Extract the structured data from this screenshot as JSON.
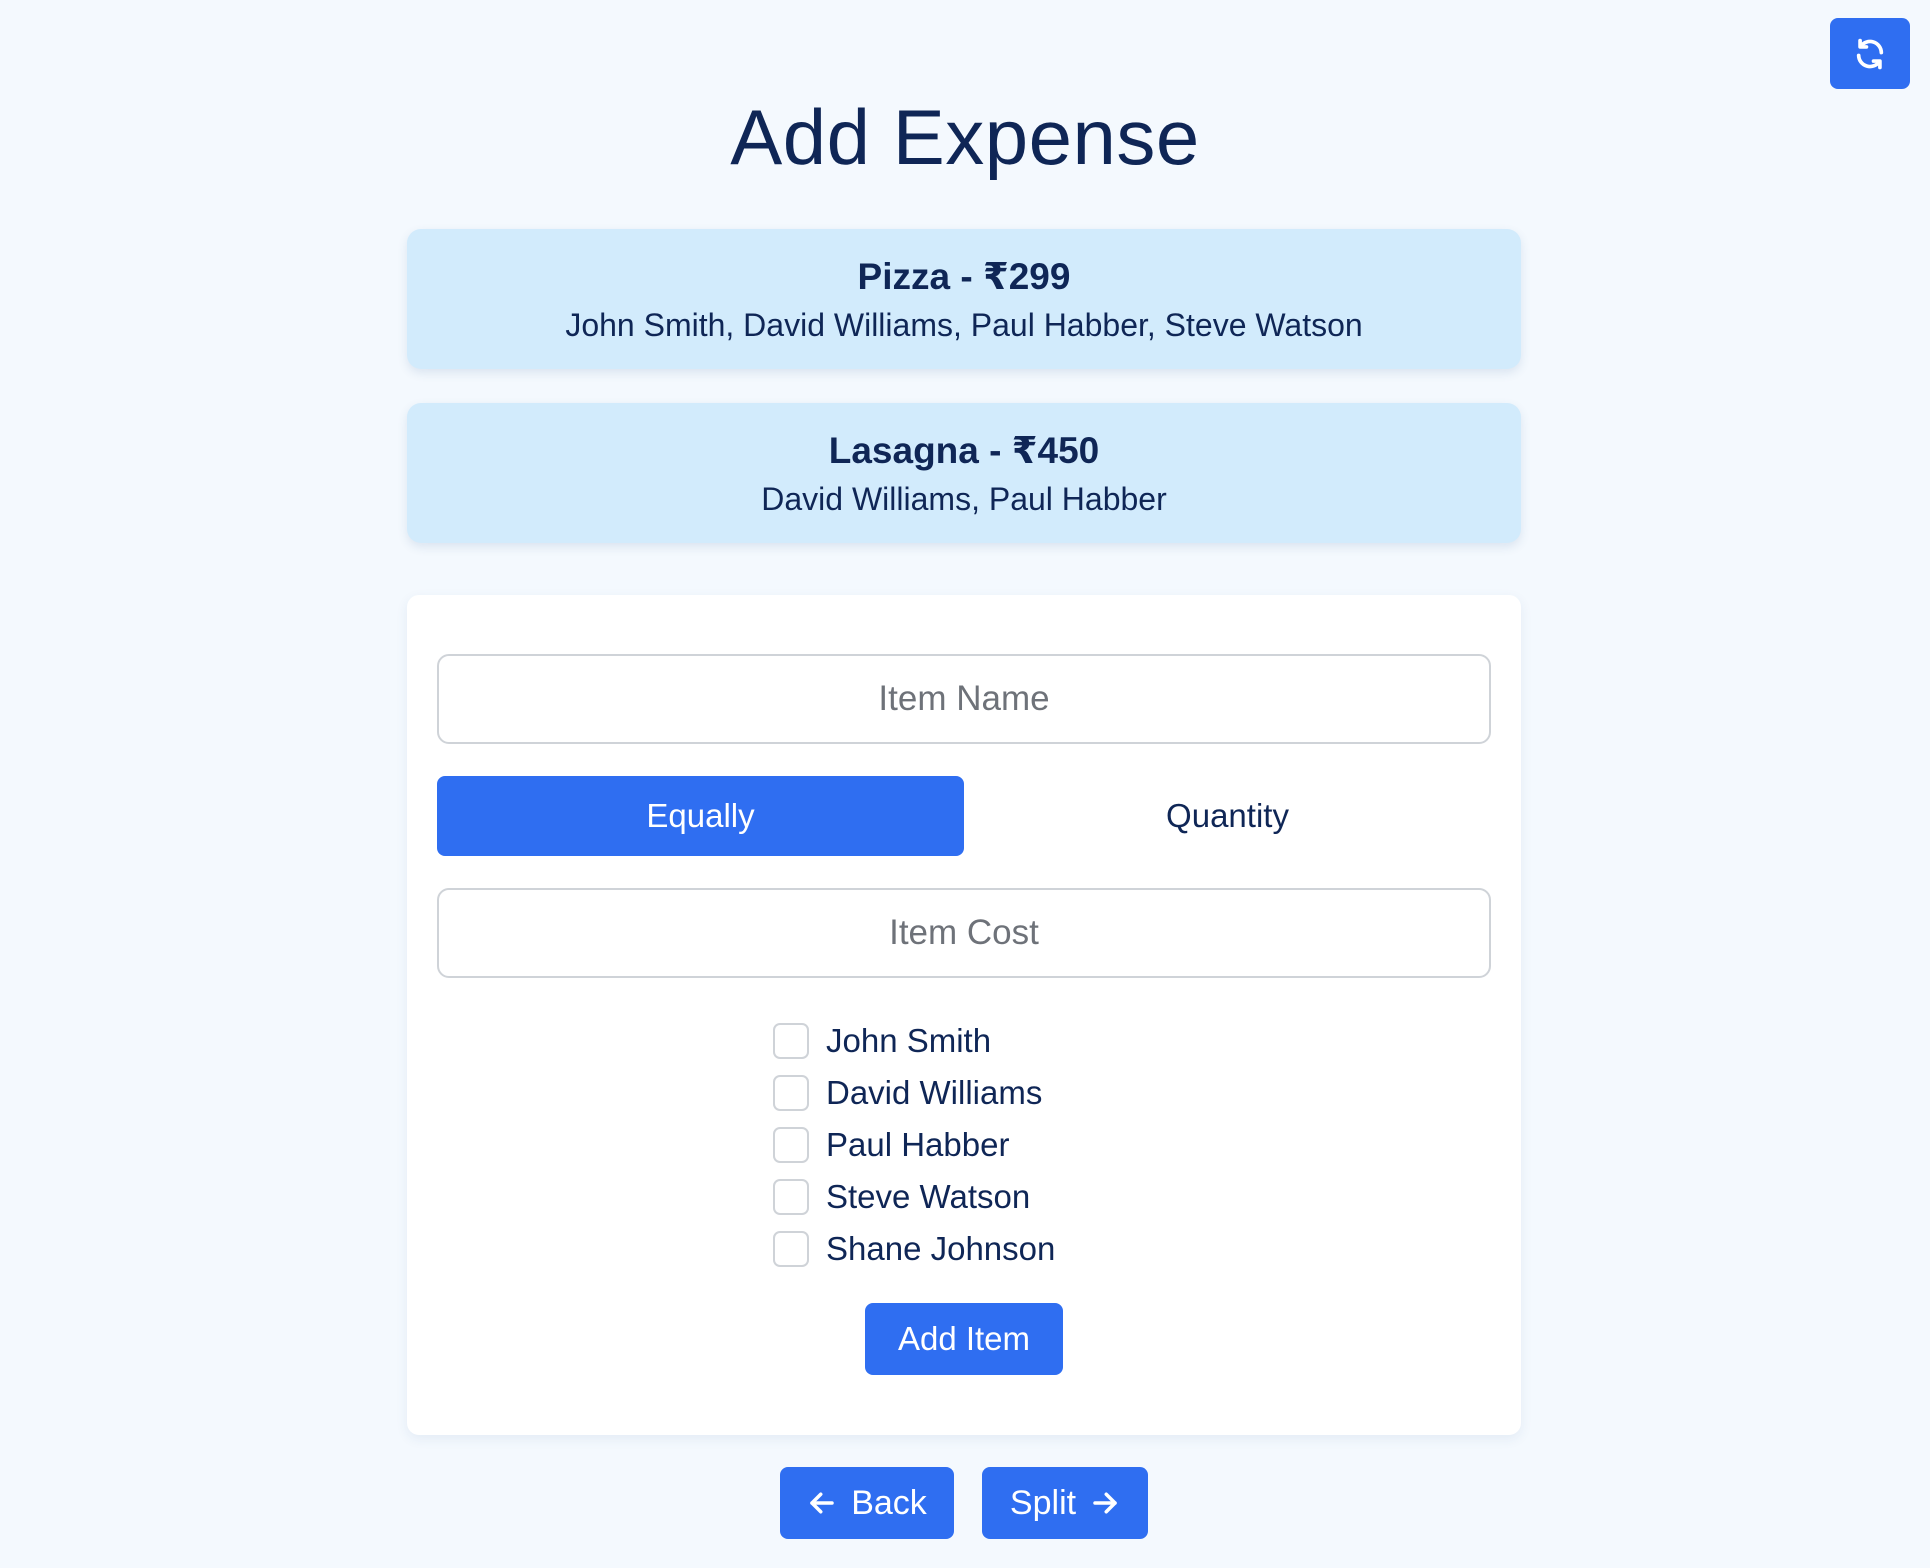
{
  "header": {
    "title": "Add Expense",
    "refresh_icon": "refresh-icon"
  },
  "expenses": [
    {
      "title": "Pizza - ₹299",
      "people": "John Smith, David Williams, Paul Habber, Steve Watson"
    },
    {
      "title": "Lasagna - ₹450",
      "people": "David Williams, Paul Habber"
    }
  ],
  "form": {
    "item_name_placeholder": "Item Name",
    "item_name_value": "",
    "split_modes": {
      "equally": "Equally",
      "quantity": "Quantity",
      "selected": "Equally"
    },
    "item_cost_placeholder": "Item Cost",
    "item_cost_value": "",
    "people": [
      {
        "name": "John Smith",
        "checked": false
      },
      {
        "name": "David Williams",
        "checked": false
      },
      {
        "name": "Paul Habber",
        "checked": false
      },
      {
        "name": "Steve Watson",
        "checked": false
      },
      {
        "name": "Shane Johnson",
        "checked": false
      }
    ],
    "add_item_label": "Add Item"
  },
  "nav": {
    "back_label": "Back",
    "back_icon": "arrow-left-icon",
    "split_label": "Split",
    "split_icon": "arrow-right-icon"
  },
  "colors": {
    "accent": "#2f6ef1",
    "text": "#0f2656",
    "card_bg": "#d2ebfc",
    "page_bg": "#f4f9fe"
  }
}
